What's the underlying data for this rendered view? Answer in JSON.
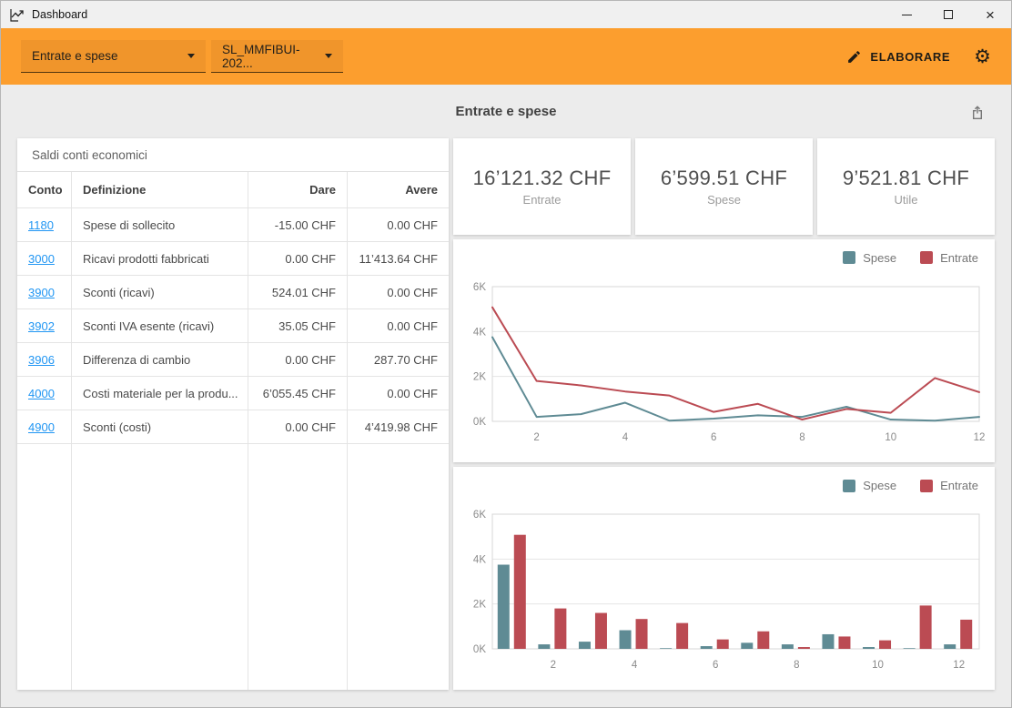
{
  "window": {
    "title": "Dashboard"
  },
  "toolbar": {
    "dashboard_select_value": "Entrate e spese",
    "file_select_value": "SL_MMFIBUI-202...",
    "elaborate_label": "ELABORARE"
  },
  "page": {
    "title": "Entrate e spese"
  },
  "table": {
    "title": "Saldi conti economici",
    "columns": [
      "Conto",
      "Definizione",
      "Dare",
      "Avere"
    ],
    "rows": [
      {
        "conto": "1180",
        "definizione": "Spese di sollecito",
        "dare": "-15.00 CHF",
        "avere": "0.00 CHF"
      },
      {
        "conto": "3000",
        "definizione": "Ricavi prodotti fabbricati",
        "dare": "0.00 CHF",
        "avere": "11’413.64 CHF"
      },
      {
        "conto": "3900",
        "definizione": "Sconti (ricavi)",
        "dare": "524.01 CHF",
        "avere": "0.00 CHF"
      },
      {
        "conto": "3902",
        "definizione": "Sconti IVA esente (ricavi)",
        "dare": "35.05 CHF",
        "avere": "0.00 CHF"
      },
      {
        "conto": "3906",
        "definizione": "Differenza di cambio",
        "dare": "0.00 CHF",
        "avere": "287.70 CHF"
      },
      {
        "conto": "4000",
        "definizione": "Costi materiale per la produ...",
        "dare": "6’055.45 CHF",
        "avere": "0.00 CHF"
      },
      {
        "conto": "4900",
        "definizione": "Sconti (costi)",
        "dare": "0.00 CHF",
        "avere": "4’419.98 CHF"
      }
    ]
  },
  "cards": [
    {
      "value": "16’121.32 CHF",
      "label": "Entrate"
    },
    {
      "value": "6’599.51 CHF",
      "label": "Spese"
    },
    {
      "value": "9’521.81 CHF",
      "label": "Utile"
    }
  ],
  "chart_data": [
    {
      "type": "line",
      "x": [
        1,
        2,
        3,
        4,
        5,
        6,
        7,
        8,
        9,
        10,
        11,
        12
      ],
      "series": [
        {
          "name": "Spese",
          "color": "#5f8b94",
          "values": [
            3750,
            200,
            320,
            830,
            30,
            120,
            270,
            200,
            650,
            80,
            30,
            200
          ]
        },
        {
          "name": "Entrate",
          "color": "#bb4b53",
          "values": [
            5080,
            1800,
            1600,
            1330,
            1150,
            420,
            780,
            80,
            550,
            380,
            1930,
            1300
          ]
        }
      ],
      "title": "",
      "xlabel": "",
      "ylabel": "",
      "ylim": [
        0,
        6000
      ],
      "yticks": [
        0,
        2000,
        4000,
        6000
      ],
      "ytick_labels": [
        "0K",
        "2K",
        "4K",
        "6K"
      ],
      "xticks": [
        2,
        4,
        6,
        8,
        10,
        12
      ],
      "grid": true,
      "legend_position": "top-right"
    },
    {
      "type": "bar",
      "x": [
        1,
        2,
        3,
        4,
        5,
        6,
        7,
        8,
        9,
        10,
        11,
        12
      ],
      "series": [
        {
          "name": "Spese",
          "color": "#5f8b94",
          "values": [
            3750,
            200,
            320,
            830,
            30,
            120,
            270,
            200,
            650,
            80,
            30,
            200
          ]
        },
        {
          "name": "Entrate",
          "color": "#bb4b53",
          "values": [
            5080,
            1800,
            1600,
            1330,
            1150,
            420,
            780,
            80,
            550,
            380,
            1930,
            1300
          ]
        }
      ],
      "title": "",
      "xlabel": "",
      "ylabel": "",
      "ylim": [
        0,
        6000
      ],
      "yticks": [
        0,
        2000,
        4000,
        6000
      ],
      "ytick_labels": [
        "0K",
        "2K",
        "4K",
        "6K"
      ],
      "xticks": [
        2,
        4,
        6,
        8,
        10,
        12
      ],
      "grid": true,
      "legend_position": "top-right"
    }
  ],
  "colors": {
    "accent_orange": "#fc9e2e",
    "spese": "#5f8b94",
    "entrate": "#bb4b53",
    "link_blue": "#2196f3",
    "axis_text": "#8a8a8a",
    "grid_line": "#e5e5e5",
    "plot_border": "#d7d7d7"
  },
  "icons": {
    "app": "trend-chart-icon",
    "edit": "pencil-icon",
    "settings": "gear-icon",
    "export": "share-icon"
  }
}
